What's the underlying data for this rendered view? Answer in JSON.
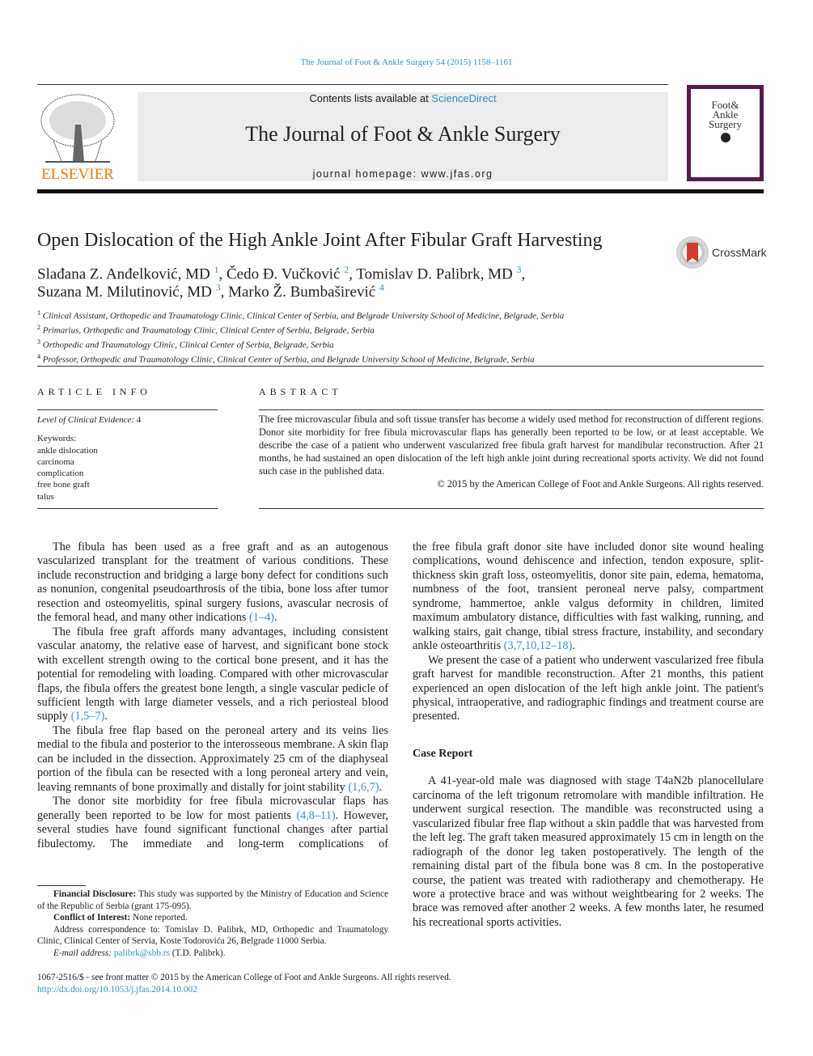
{
  "header": {
    "journal_ref": "The Journal of Foot & Ankle Surgery 54 (2015) 1158–1161",
    "contents_prefix": "Contents lists available at ",
    "contents_link": "ScienceDirect",
    "journal_title": "The Journal of Foot & Ankle Surgery",
    "homepage": "journal homepage: www.jfas.org",
    "publisher_logo": "ELSEVIER",
    "cover_title": "Foot& Ankle Surgery",
    "crossmark": "CrossMark"
  },
  "article": {
    "title": "Open Dislocation of the High Ankle Joint After Fibular Graft Harvesting",
    "authors": [
      {
        "name": "Slađana Z. Anđelković, MD",
        "sup": "1"
      },
      {
        "name": "Čedo Đ. Vučković",
        "sup": "2"
      },
      {
        "name": "Tomislav D. Palibrk, MD",
        "sup": "3"
      },
      {
        "name": "Suzana M. Milutinović, MD",
        "sup": "3"
      },
      {
        "name": "Marko Ž. Bumbaširević",
        "sup": "4"
      }
    ],
    "affiliations": [
      {
        "n": "1",
        "text": "Clinical Assistant, Orthopedic and Traumatology Clinic, Clinical Center of Serbia, and Belgrade University School of Medicine, Belgrade, Serbia"
      },
      {
        "n": "2",
        "text": "Primarius, Orthopedic and Traumatology Clinic, Clinical Center of Serbia, Belgrade, Serbia"
      },
      {
        "n": "3",
        "text": "Orthopedic and Traumatology Clinic, Clinical Center of Serbia, Belgrade, Serbia"
      },
      {
        "n": "4",
        "text": "Professor, Orthopedic and Traumatology Clinic, Clinical Center of Serbia, and Belgrade University School of Medicine, Belgrade, Serbia"
      }
    ]
  },
  "article_info": {
    "heading": "ARTICLE INFO",
    "evidence_label": "Level of Clinical Evidence:",
    "evidence_value": "4",
    "keywords_label": "Keywords:",
    "keywords": [
      "ankle dislocation",
      "carcinoma",
      "complication",
      "free bone graft",
      "talus"
    ]
  },
  "abstract": {
    "heading": "ABSTRACT",
    "text": "The free microvascular fibula and soft tissue transfer has become a widely used method for reconstruction of different regions. Donor site morbidity for free fibula microvascular flaps has generally been reported to be low, or at least acceptable. We describe the case of a patient who underwent vascularized free fibula graft harvest for mandibular reconstruction. After 21 months, he had sustained an open dislocation of the left high ankle joint during recreational sports activity. We did not found such case in the published data.",
    "copyright": "© 2015 by the American College of Foot and Ankle Surgeons. All rights reserved."
  },
  "body": {
    "p1": {
      "a": "The fibula has been used as a free graft and as an autogenous vascularized transplant for the treatment of various conditions. These include reconstruction and bridging a large bony defect for conditions such as nonunion, congenital pseudoarthrosis of the tibia, bone loss after tumor resection and osteomyelitis, spinal surgery fusions, avascular necrosis of the femoral head, and many other indications ",
      "cite": "(1–4)",
      "b": "."
    },
    "p2": {
      "a": "The fibula free graft affords many advantages, including consistent vascular anatomy, the relative ease of harvest, and significant bone stock with excellent strength owing to the cortical bone present, and it has the potential for remodeling with loading. Compared with other microvascular flaps, the fibula offers the greatest bone length, a single vascular pedicle of sufficient length with large diameter vessels, and a rich periosteal blood supply ",
      "cite": "(1,5–7)",
      "b": "."
    },
    "p3": {
      "a": "The fibula free flap based on the peroneal artery and its veins lies medial to the fibula and posterior to the interosseous membrane. A skin flap can be included in the dissection. Approximately 25 cm of the diaphyseal portion of the fibula can be resected with a long peroneal artery and vein, leaving remnants of bone proximally and distally for joint stability ",
      "cite": "(1,6,7)",
      "b": "."
    },
    "p4": {
      "a": "The donor site morbidity for free fibula microvascular flaps has generally been reported to be low for most patients ",
      "cite": "(4,8–11)",
      "b": ". However, several studies have found significant functional changes after partial fibulectomy. The immediate and long-term complications of"
    },
    "p5": {
      "a": "the free fibula graft donor site have included donor site wound healing complications, wound dehiscence and infection, tendon exposure, split-thickness skin graft loss, osteomyelitis, donor site pain, edema, hematoma, numbness of the foot, transient peroneal nerve palsy, compartment syndrome, hammertoe, ankle valgus deformity in children, limited maximum ambulatory distance, difficulties with fast walking, running, and walking stairs, gait change, tibial stress fracture, instability, and secondary ankle osteoarthritis ",
      "cite": "(3,7,10,12–18)",
      "b": "."
    },
    "p6": "We present the case of a patient who underwent vascularized free fibula graft harvest for mandible reconstruction. After 21 months, this patient experienced an open dislocation of the left high ankle joint. The patient's physical, intraoperative, and radiographic findings and treatment course are presented.",
    "case_heading": "Case Report",
    "p7": "A 41-year-old male was diagnosed with stage T4aN2b planocellulare carcinoma of the left trigonum retromolare with mandible infiltration. He underwent surgical resection. The mandible was reconstructed using a vascularized fibular free flap without a skin paddle that was harvested from the left leg. The graft taken measured approximately 15 cm in length on the radiograph of the donor leg taken postoperatively. The length of the remaining distal part of the fibula bone was 8 cm. In the postoperative course, the patient was treated with radiotherapy and chemotherapy. He wore a protective brace and was without weightbearing for 2 weeks. The brace was removed after another 2 weeks. A few months later, he resumed his recreational sports activities."
  },
  "footnotes": {
    "fin_label": "Financial Disclosure:",
    "fin_text": " This study was supported by the Ministry of Education and Science of the Republic of Serbia (grant 175-095).",
    "coi_label": "Conflict of Interest:",
    "coi_text": " None reported.",
    "address": "Address correspondence to: Tomislav D. Palibrk, MD, Orthopedic and Traumatology Clinic, Clinical Center of Servia, Koste Todorovića 26, Belgrade 11000 Serbia.",
    "email_label": "E-mail address:",
    "email": "palibrk@sbb.rs",
    "email_suffix": " (T.D. Palibrk)."
  },
  "bottom": {
    "issn": "1067-2516/$ - see front matter © 2015 by the American College of Foot and Ankle Surgeons. All rights reserved.",
    "doi": "http://dx.doi.org/10.1053/j.jfas.2014.10.002"
  }
}
